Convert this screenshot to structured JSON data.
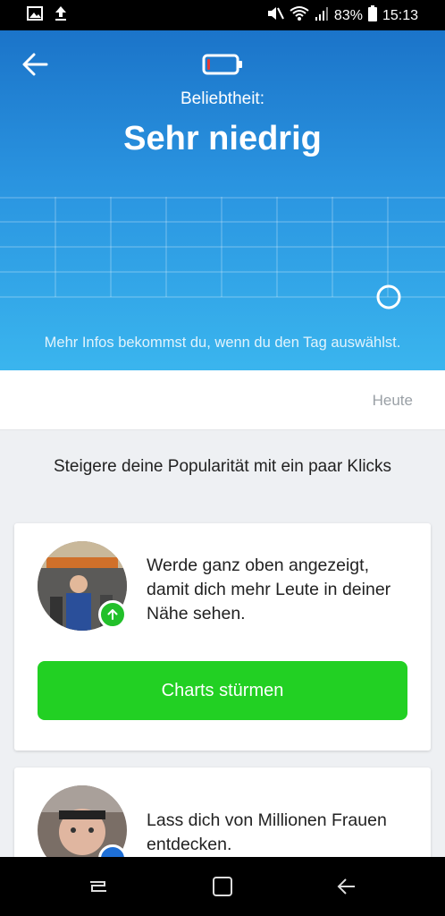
{
  "status_bar": {
    "battery_percent": "83%",
    "time": "15:13",
    "icons": [
      "image-icon",
      "upload-icon",
      "mute-icon",
      "wifi-icon",
      "signal-icon",
      "battery-icon"
    ]
  },
  "hero": {
    "popularity_label": "Beliebtheit:",
    "popularity_value": "Sehr niedrig",
    "hint": "Mehr Infos bekommst du, wenn du den Tag auswählst.",
    "battery_level": 0.1,
    "colors": {
      "gradient_top": "#1b74c9",
      "gradient_bottom": "#3ab5ee",
      "battery_fill": "#e53935"
    }
  },
  "date_strip": {
    "today_label": "Heute"
  },
  "boost": {
    "heading": "Steigere deine Popularität mit ein paar Klicks",
    "cards": [
      {
        "text": "Werde ganz oben angezeigt, damit dich mehr Leute in deiner Nähe sehen.",
        "button_label": "Charts stürmen",
        "badge_icon": "arrow-up-icon",
        "badge_color": "#22c02a"
      },
      {
        "text": "Lass dich von Millionen Frauen entdecken.",
        "badge_color": "#1e6fd6"
      }
    ],
    "button_color": "#22d023"
  }
}
